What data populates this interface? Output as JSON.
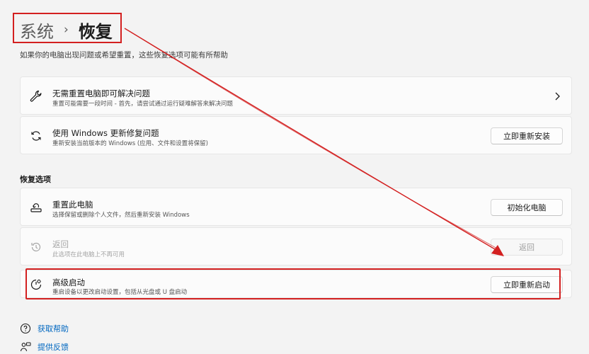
{
  "header": {
    "parent": "系统",
    "separator": "›",
    "current": "恢复"
  },
  "subtitle": "如果你的电脑出现问题或希望重置，这些恢复选项可能有所帮助",
  "cards": {
    "fix": {
      "title": "无需重置电脑即可解决问题",
      "desc": "重置可能需要一段时间 - 首先，请尝试通过运行疑难解答来解决问题",
      "icon": "wrench-icon"
    },
    "update": {
      "title": "使用 Windows 更新修复问题",
      "desc": "重新安装当前版本的 Windows (应用、文件和设置将保留)",
      "button": "立即重新安装",
      "icon": "sync-icon"
    }
  },
  "recovery": {
    "section_label": "恢复选项",
    "reset": {
      "title": "重置此电脑",
      "desc": "选择保留或删除个人文件，然后重新安装 Windows",
      "button": "初始化电脑",
      "icon": "reset-pc-icon"
    },
    "goback": {
      "title": "返回",
      "desc": "此选项在此电脑上不再可用",
      "button": "返回",
      "icon": "history-icon"
    },
    "advanced": {
      "title": "高级启动",
      "desc": "重启设备以更改启动设置，包括从光盘或 U 盘启动",
      "button": "立即重新启动",
      "icon": "advanced-startup-icon"
    }
  },
  "links": {
    "help": "获取帮助",
    "feedback": "提供反馈"
  },
  "colors": {
    "annotation": "#d32020",
    "link": "#0067c0",
    "background": "#f3f3f3",
    "card": "#fbfbfb"
  }
}
